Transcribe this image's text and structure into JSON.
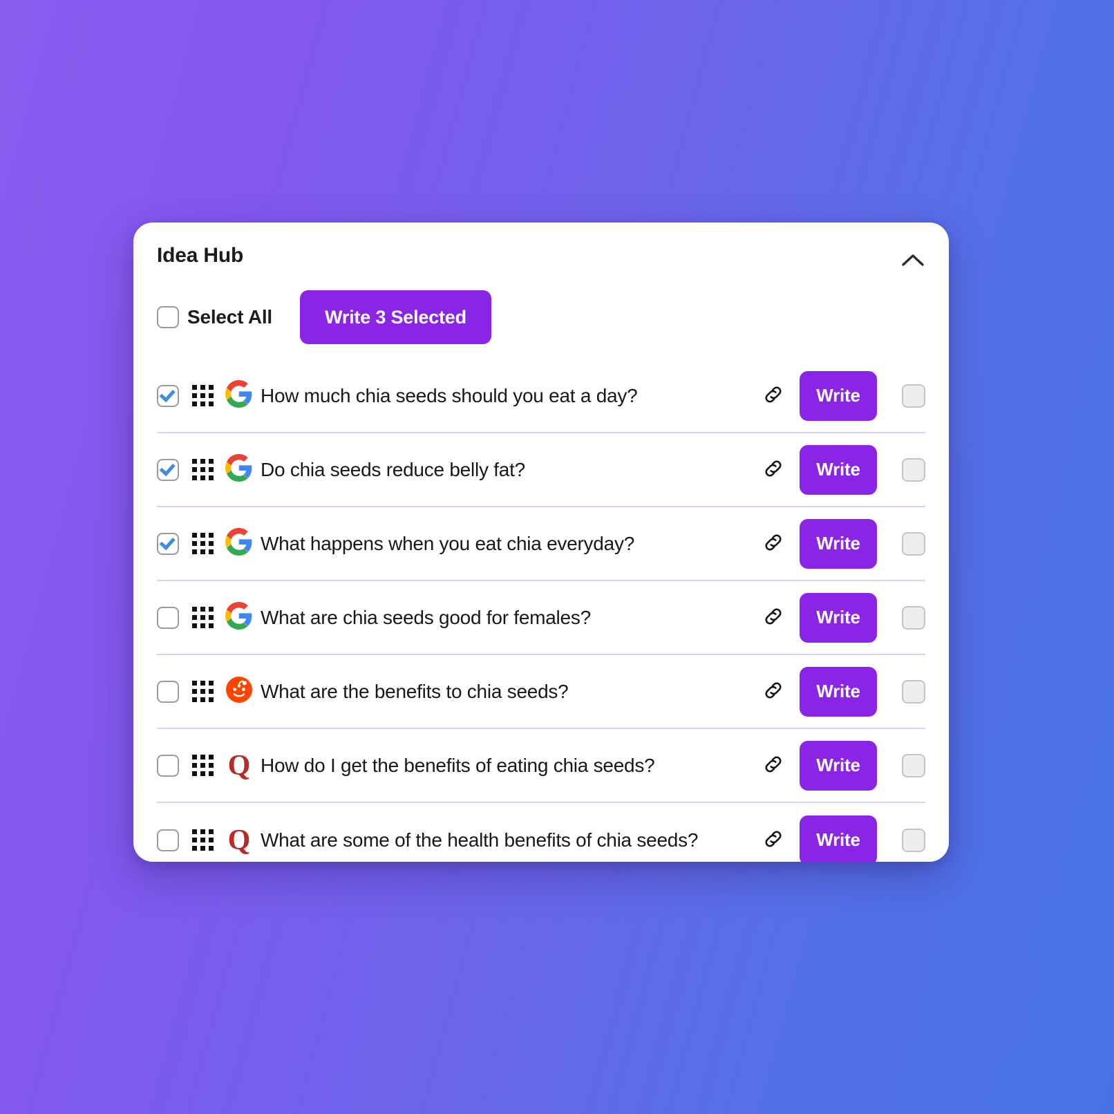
{
  "card": {
    "title": "Idea Hub",
    "collapse_icon": "chevron-up-icon"
  },
  "toolbar": {
    "select_all_label": "Select All",
    "select_all_checked": false,
    "write_selected_label": "Write 3 Selected",
    "selected_count": 3
  },
  "colors": {
    "primary_purple": "#8A25E6",
    "checkmark_blue": "#3F8DDB",
    "divider": "#DDD2EE",
    "google_blue": "#4285F4",
    "google_red": "#EA4335",
    "google_yellow": "#FBBC05",
    "google_green": "#34A853",
    "reddit_orange": "#FF4500",
    "quora_red": "#B92B27",
    "bg_gradient_start": "#8B5CF0",
    "bg_gradient_end": "#4772E6"
  },
  "row_actions": {
    "link_icon": "link-icon",
    "drag_icon": "drag-handle-icon",
    "write_label": "Write"
  },
  "rows": [
    {
      "checked": true,
      "source": "google",
      "text": "How much chia seeds should you eat a day?"
    },
    {
      "checked": true,
      "source": "google",
      "text": "Do chia seeds reduce belly fat?"
    },
    {
      "checked": true,
      "source": "google",
      "text": "What happens when you eat chia everyday?"
    },
    {
      "checked": false,
      "source": "google",
      "text": "What are chia seeds good for females?"
    },
    {
      "checked": false,
      "source": "reddit",
      "text": "What are the benefits to chia seeds?"
    },
    {
      "checked": false,
      "source": "quora",
      "text": "How do I get the benefits of eating chia seeds?"
    },
    {
      "checked": false,
      "source": "quora",
      "text": "What are some of the health benefits of chia seeds?"
    }
  ]
}
